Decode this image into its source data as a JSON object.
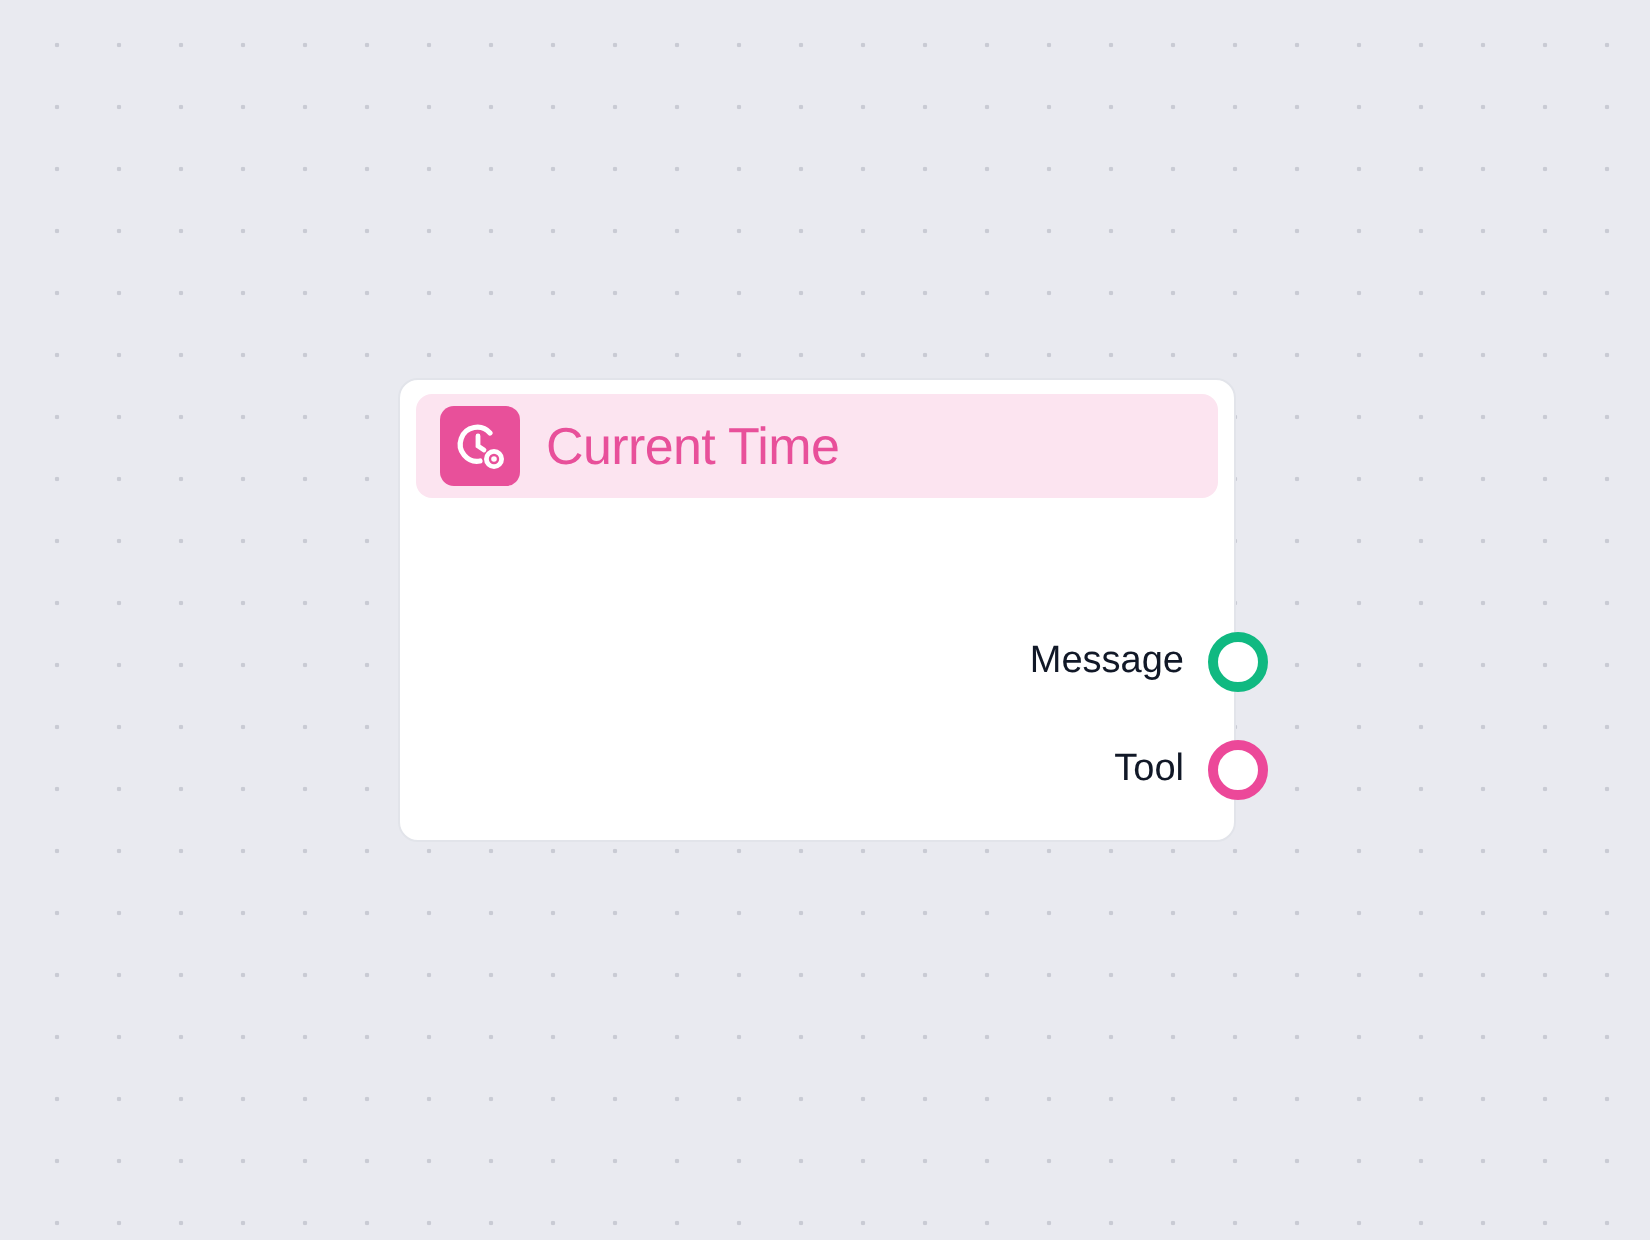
{
  "node": {
    "title": "Current Time",
    "outputs": [
      {
        "label": "Message",
        "color": "#10b981"
      },
      {
        "label": "Tool",
        "color": "#ec4899"
      }
    ]
  }
}
